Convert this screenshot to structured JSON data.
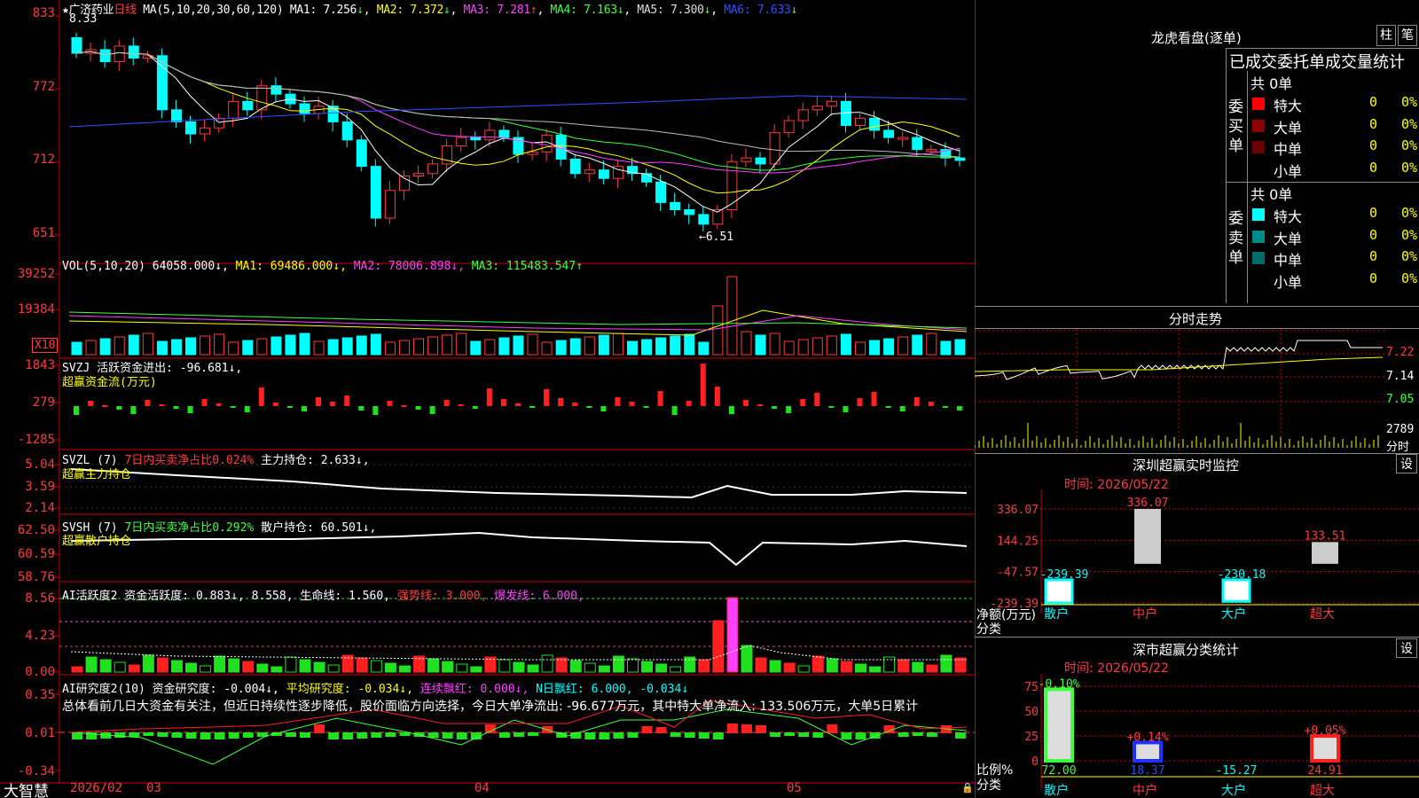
{
  "stock": {
    "name": "广济药业",
    "period": "日线",
    "ma_label": "MA(5,10,20,30,60,120)",
    "ma1": "MA1: 7.256",
    "ma2": "MA2: 7.372",
    "ma3": "MA3: 7.281",
    "ma4": "MA4: 7.163",
    "ma5": "MA5: 7.300",
    "ma6": "MA6: 7.633",
    "arrow_down": "↓",
    "arrow_up": "↑",
    "star": "★",
    "high_mark": "8.33",
    "low_mark": "←6.51"
  },
  "main_axis": [
    "833",
    "772",
    "712",
    "651"
  ],
  "vol": {
    "label": "VOL(5,10,20)",
    "val": "64058.000↓,",
    "ma1": "MA1: 69486.000↓,",
    "ma2": "MA2: 78006.898↓,",
    "ma3": "MA3: 115483.547↑",
    "axis": [
      "39252",
      "19384"
    ],
    "unit": "X10"
  },
  "svzj": {
    "label": "SVZJ  活跃资金进出: -96.681↓,",
    "sub": "超赢资金流(万元)",
    "axis": [
      "1843",
      "279",
      "-1285"
    ]
  },
  "svzl": {
    "label": "SVZL (7) ",
    "pct": "7日内买卖净占比0.024%",
    "hold": " 主力持仓: 2.633↓,",
    "sub": "超赢主力持仓",
    "axis": [
      "5.04",
      "3.59",
      "2.14"
    ]
  },
  "svsh": {
    "label": "SVSH (7) ",
    "pct": "7日内买卖净占比0.292%",
    "hold": " 散户持仓: 60.501↓,",
    "sub": "超赢散户持仓",
    "axis": [
      "62.50",
      "60.59",
      "58.76"
    ]
  },
  "ai1": {
    "label": "AI活跃度2 资金活跃度: 0.883↓, 8.558, 生命线: 1.560, ",
    "strong": "强势线: 3.000,",
    "burst": " 爆发线: 6.000,",
    "axis": [
      "8.56",
      "4.23",
      "0.00"
    ]
  },
  "ai2": {
    "label": "AI研究度2(10) 资金研究度: -0.004↓,",
    "avg": " 平均研究度: -0.034↓,",
    "red": " 连续飘红: 0.000↓,",
    "nred": " N日飘红: 6.000, -0.034↓",
    "comment": "总体看前几日大资金有关注，但近日持续性逐步降低，股价面临方向选择，今日大单净流出: -96.677万元，其中特大单净流入: 133.506万元，大单5日累计",
    "axis": [
      "0.35",
      "0.01",
      "-0.34"
    ]
  },
  "timeline": {
    "brand": "大智慧",
    "labels": [
      "2026/02",
      "03",
      "04",
      "05"
    ]
  },
  "lhb": {
    "title": "龙虎看盘(逐单)",
    "btn1": "柱",
    "btn2": "笔",
    "subtitle": "已成交委托单成交量统计",
    "buy_total": "共 0单",
    "sell_total": "共 0单",
    "buy_label": "委买单",
    "sell_label": "委卖单",
    "rows": [
      {
        "name": "特大",
        "count": "0",
        "pct": "0%"
      },
      {
        "name": "大单",
        "count": "0",
        "pct": "0%"
      },
      {
        "name": "中单",
        "count": "0",
        "pct": "0%"
      },
      {
        "name": "小单",
        "count": "0",
        "pct": "0%"
      }
    ],
    "buy_colors": [
      "#ff0000",
      "#8b0000",
      "#6b0000",
      ""
    ],
    "sell_colors": [
      "#00ffff",
      "#008b8b",
      "#006b6b",
      ""
    ]
  },
  "intraday": {
    "title": "分时走势",
    "axis": [
      "7.22",
      "7.14",
      "7.05"
    ],
    "vol_axis": "2789",
    "vol_unit": "分时"
  },
  "sz_monitor": {
    "title": "深圳超赢实时监控",
    "btn": "设",
    "time": "时间: 2026/05/22",
    "axis": [
      "336.07",
      "144.25",
      "-47.57",
      "-239.39"
    ],
    "ylabel1": "净额(万元)",
    "ylabel2": "分类",
    "cats": [
      "散户",
      "中户",
      "大户",
      "超大"
    ],
    "values": [
      -239.39,
      336.07,
      -230.18,
      133.51
    ],
    "value_labels": [
      "-239.39",
      "336.07",
      "-230.18",
      "133.51"
    ]
  },
  "sz_stats": {
    "title": "深市超赢分类统计",
    "btn": "设",
    "time": "时间: 2026/05/22",
    "axis": [
      "75",
      "50",
      "25",
      "0"
    ],
    "ylabel1": "比例%",
    "ylabel2": "分类",
    "cats": [
      "散户",
      "中户",
      "大户",
      "超大"
    ],
    "values": [
      72.0,
      18.37,
      -15.27,
      24.91
    ],
    "value_labels": [
      "72.00",
      "18.37",
      "-15.27",
      "24.91"
    ],
    "pct_labels": [
      "-0.10%",
      "+0.14%",
      "",
      "+0.05%"
    ]
  }
}
